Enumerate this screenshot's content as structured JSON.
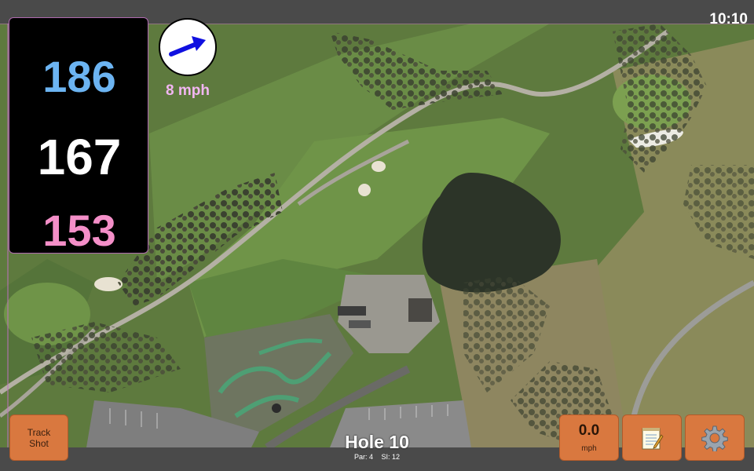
{
  "status": {
    "clock": "10:10"
  },
  "distances": {
    "back": "186",
    "middle": "167",
    "front": "153",
    "colors": {
      "back": "#6cb4f2",
      "middle": "#ffffff",
      "front": "#f48fc8"
    }
  },
  "wind": {
    "label": "8 mph",
    "arrow_icon": "wind-arrow-icon",
    "color": "#f2b6f2",
    "arrow_color": "#1010e0"
  },
  "hole": {
    "title": "Hole 10",
    "par_label": "Par: 4",
    "si_label": "SI: 12"
  },
  "buttons": {
    "track_shot_line1": "Track",
    "track_shot_line2": "Shot",
    "speed_value": "0.0",
    "speed_unit": "mph",
    "notes_icon": "notepad-icon",
    "settings_icon": "gear-icon",
    "color": "#d9783f"
  },
  "map": {
    "view": "satellite",
    "accent_border": "#c070c0"
  }
}
